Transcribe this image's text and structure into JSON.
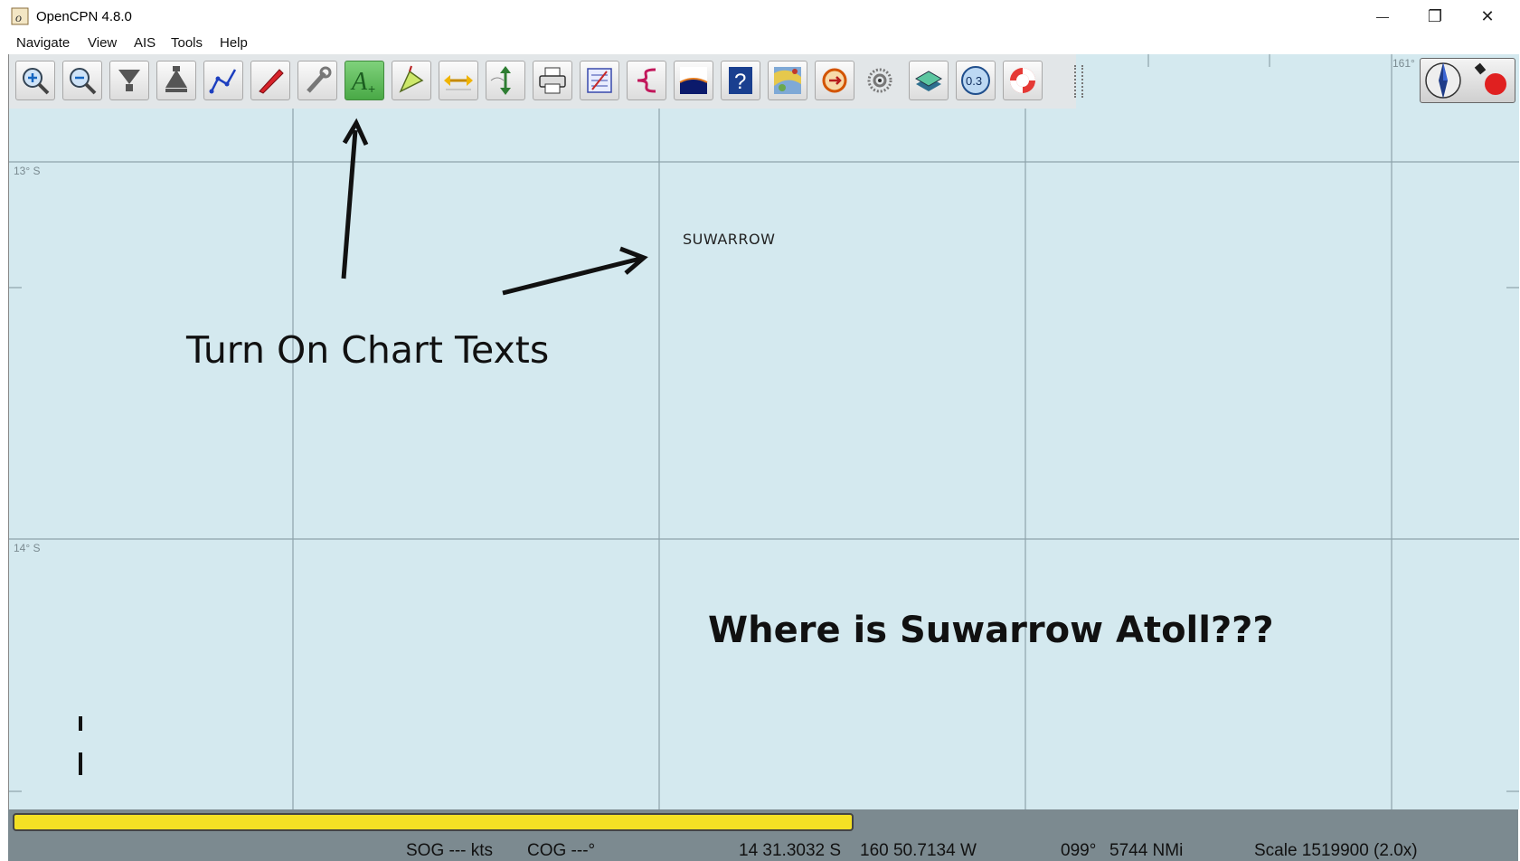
{
  "window": {
    "title": "OpenCPN 4.8.0",
    "minimize_glyph": "—",
    "restore_glyph": "❐",
    "close_glyph": "✕"
  },
  "menu": [
    "Navigate",
    "View",
    "AIS",
    "Tools",
    "Help"
  ],
  "toolbar": {
    "buttons": [
      {
        "name": "zoom-in-icon"
      },
      {
        "name": "zoom-out-icon"
      },
      {
        "name": "scale-down-icon"
      },
      {
        "name": "scale-up-icon"
      },
      {
        "name": "route-icon"
      },
      {
        "name": "ship-icon"
      },
      {
        "name": "settings-wrench-icon"
      },
      {
        "name": "chart-text-icon",
        "active": true
      },
      {
        "name": "route-manager-icon"
      },
      {
        "name": "auto-follow-icon"
      },
      {
        "name": "tides-currents-icon"
      },
      {
        "name": "print-icon"
      },
      {
        "name": "route-list-icon"
      },
      {
        "name": "track-icon"
      },
      {
        "name": "color-scheme-icon"
      },
      {
        "name": "help-icon"
      },
      {
        "name": "chart-quilt-icon"
      },
      {
        "name": "mob-recovery-icon"
      },
      {
        "name": "ais-icon"
      },
      {
        "name": "layers-icon"
      },
      {
        "name": "chart-group-icon",
        "text": "0.3"
      },
      {
        "name": "lifebuoy-icon"
      }
    ]
  },
  "chart": {
    "lat_labels": [
      "13° S",
      "14° S"
    ],
    "lon_label": "161°",
    "place_label": "SUWARROW"
  },
  "annotations": {
    "turn_on": "Turn On Chart Texts",
    "question": "Where is Suwarrow Atoll???"
  },
  "status": {
    "progress": 0.56,
    "sog": "SOG --- kts",
    "cog": "COG ---°",
    "lat": "14 31.3032 S",
    "lon": "160 50.7134 W",
    "bearing": "099°",
    "distance": "5744 NMi",
    "scale": "Scale 1519900 (2.0x)"
  },
  "colors": {
    "sea": "#d4e9ef",
    "progress": "#f4e024",
    "active_button": "#49a946"
  }
}
